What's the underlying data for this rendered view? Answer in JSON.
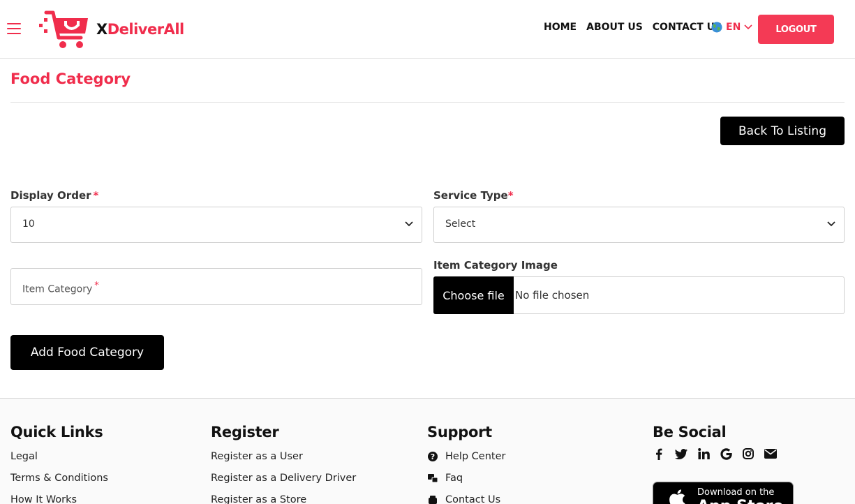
{
  "header": {
    "brand_x": "X",
    "brand_rest": "DeliverAll",
    "nav": [
      "HOME",
      "ABOUT US",
      "CONTACT US"
    ],
    "language": "EN",
    "logout_label": "LOGOUT"
  },
  "main": {
    "title": "Food Category",
    "back_label": "Back To Listing",
    "display_order": {
      "label": "Display Order",
      "required": "*",
      "value": "10"
    },
    "service_type": {
      "label": "Service Type",
      "required": "*",
      "value": "Select"
    },
    "item_category": {
      "placeholder": "Item Category",
      "required": "*"
    },
    "item_image": {
      "label": "Item Category Image",
      "button": "Choose file",
      "status": "No file chosen"
    },
    "submit_label": "Add Food Category"
  },
  "footer": {
    "quick_links": {
      "heading": "Quick Links",
      "items": [
        "Legal",
        "Terms & Conditions",
        "How It Works"
      ]
    },
    "register": {
      "heading": "Register",
      "items": [
        "Register as a User",
        "Register as a Delivery Driver",
        "Register as a Store"
      ]
    },
    "support": {
      "heading": "Support",
      "items": [
        "Help Center",
        "Faq",
        "Contact Us"
      ]
    },
    "social": {
      "heading": "Be Social",
      "icons": [
        "facebook-icon",
        "twitter-icon",
        "linkedin-icon",
        "google-icon",
        "instagram-icon",
        "mail-icon"
      ]
    },
    "appstore": {
      "small": "Download on the",
      "big": "App Store"
    }
  },
  "colors": {
    "accent": "#f02d4c",
    "dark": "#000000"
  }
}
